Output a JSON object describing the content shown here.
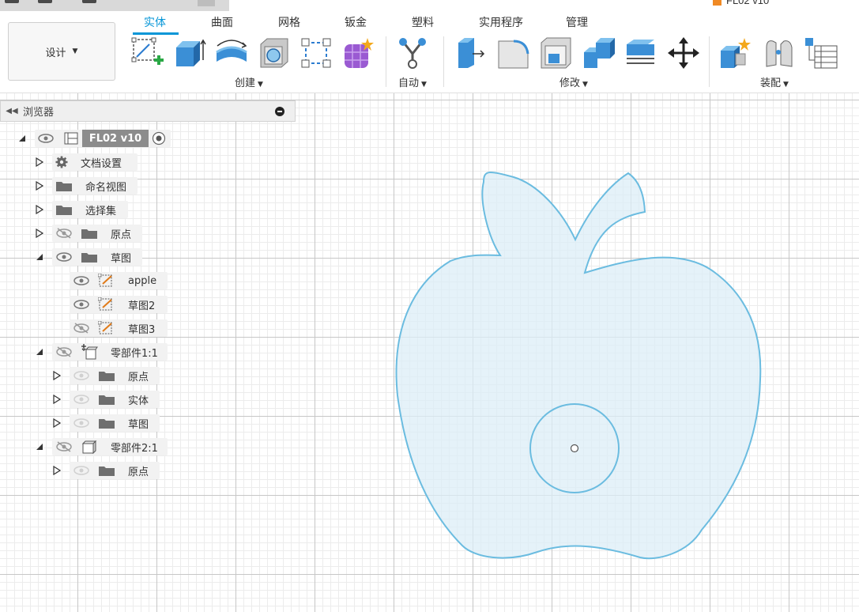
{
  "window": {
    "document_title": "FL02 v10"
  },
  "tabs": [
    {
      "label": "实体",
      "active": true
    },
    {
      "label": "曲面",
      "active": false
    },
    {
      "label": "网格",
      "active": false
    },
    {
      "label": "钣金",
      "active": false
    },
    {
      "label": "塑料",
      "active": false
    },
    {
      "label": "实用程序",
      "active": false
    },
    {
      "label": "管理",
      "active": false
    }
  ],
  "toolbar": {
    "workspace_label": "设计",
    "groups": [
      {
        "label": "创建",
        "tools": [
          "create-sketch-icon",
          "extrude-icon",
          "revolve-icon",
          "shell-icon",
          "pattern-icon",
          "create-form-icon"
        ]
      },
      {
        "label": "自动",
        "tools": [
          "automated-modeling-icon"
        ]
      },
      {
        "label": "修改",
        "tools": [
          "press-pull-icon",
          "fillet-icon",
          "shell-modify-icon",
          "combine-icon",
          "offset-face-icon",
          "move-copy-icon"
        ]
      },
      {
        "label": "装配",
        "tools": [
          "new-component-icon",
          "joint-icon",
          "bill-of-materials-icon"
        ]
      }
    ]
  },
  "browser": {
    "title": "浏览器",
    "root": {
      "label": "FL02 v10"
    },
    "nodes": [
      {
        "label": "文档设置",
        "icon": "gear-icon"
      },
      {
        "label": "命名视图",
        "icon": "folder-icon"
      },
      {
        "label": "选择集",
        "icon": "folder-icon"
      },
      {
        "label": "原点",
        "icon": "folder-icon",
        "visible": false
      },
      {
        "label": "草图",
        "icon": "folder-icon",
        "visible": true
      },
      {
        "label": "apple",
        "icon": "sketch-icon",
        "visible": true
      },
      {
        "label": "草图2",
        "icon": "sketch-icon",
        "visible": true
      },
      {
        "label": "草图3",
        "icon": "sketch-icon",
        "visible": false
      },
      {
        "label": "零部件1:1",
        "icon": "component-icon",
        "visible": false
      },
      {
        "label": "原点",
        "icon": "folder-icon"
      },
      {
        "label": "实体",
        "icon": "folder-icon"
      },
      {
        "label": "草图",
        "icon": "folder-icon"
      },
      {
        "label": "零部件2:1",
        "icon": "component-icon",
        "visible": false
      },
      {
        "label": "原点",
        "icon": "folder-icon"
      }
    ]
  },
  "colors": {
    "accent": "#0696d7",
    "sketch_fill": "#dcedf7",
    "sketch_stroke": "#6bbce0"
  }
}
